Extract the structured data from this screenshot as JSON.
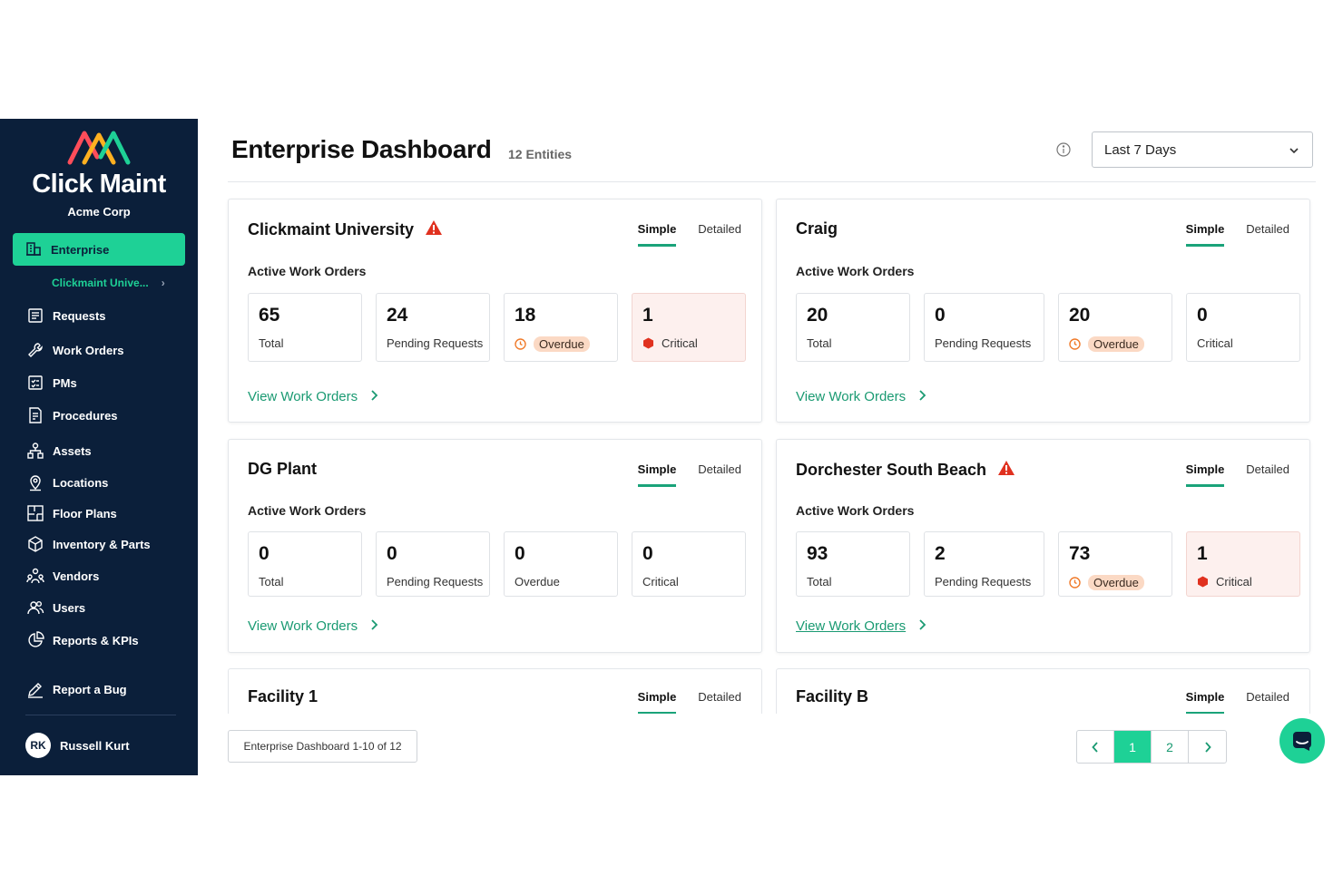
{
  "app": {
    "brand": "Click Maint",
    "org": "Acme Corp"
  },
  "sidebar": {
    "active_item": "Enterprise",
    "sub_item": "Clickmaint Unive...",
    "items": [
      {
        "label": "Requests",
        "icon": "requests-icon"
      },
      {
        "label": "Work Orders",
        "icon": "wrench-icon"
      },
      {
        "label": "PMs",
        "icon": "checklist-icon"
      },
      {
        "label": "Procedures",
        "icon": "procedure-icon"
      },
      {
        "label": "Assets",
        "icon": "assets-icon"
      },
      {
        "label": "Locations",
        "icon": "location-pin-icon"
      },
      {
        "label": "Floor Plans",
        "icon": "floor-plan-icon"
      },
      {
        "label": "Inventory & Parts",
        "icon": "box-icon"
      },
      {
        "label": "Vendors",
        "icon": "vendors-icon"
      },
      {
        "label": "Users",
        "icon": "users-icon"
      },
      {
        "label": "Reports & KPIs",
        "icon": "pie-chart-icon"
      }
    ],
    "report_bug": "Report a Bug",
    "user": {
      "initials": "RK",
      "name": "Russell Kurt"
    }
  },
  "header": {
    "title": "Enterprise Dashboard",
    "entities": "12 Entities",
    "range": "Last 7 Days"
  },
  "colors": {
    "sidebar_bg": "#0b1f3a",
    "accent": "#1ed196",
    "link": "#1a9a72",
    "warning": "#e0311f",
    "overdue_pill": "#fbd9c4"
  },
  "cards": [
    {
      "title": "Clickmaint University",
      "warning": true,
      "tab_simple": "Simple",
      "tab_detailed": "Detailed",
      "section": "Active Work Orders",
      "stats": [
        {
          "value": "65",
          "label": "Total"
        },
        {
          "value": "24",
          "label": "Pending Requests"
        },
        {
          "value": "18",
          "label": "Overdue"
        },
        {
          "value": "1",
          "label": "Critical"
        }
      ],
      "link": "View Work Orders"
    },
    {
      "title": "Craig",
      "warning": false,
      "tab_simple": "Simple",
      "tab_detailed": "Detailed",
      "section": "Active Work Orders",
      "stats": [
        {
          "value": "20",
          "label": "Total"
        },
        {
          "value": "0",
          "label": "Pending Requests"
        },
        {
          "value": "20",
          "label": "Overdue"
        },
        {
          "value": "0",
          "label": "Critical"
        }
      ],
      "link": "View Work Orders"
    },
    {
      "title": "DG Plant",
      "warning": false,
      "tab_simple": "Simple",
      "tab_detailed": "Detailed",
      "section": "Active Work Orders",
      "stats": [
        {
          "value": "0",
          "label": "Total"
        },
        {
          "value": "0",
          "label": "Pending Requests"
        },
        {
          "value": "0",
          "label": "Overdue"
        },
        {
          "value": "0",
          "label": "Critical"
        }
      ],
      "link": "View Work Orders"
    },
    {
      "title": "Dorchester South Beach",
      "warning": true,
      "tab_simple": "Simple",
      "tab_detailed": "Detailed",
      "section": "Active Work Orders",
      "stats": [
        {
          "value": "93",
          "label": "Total"
        },
        {
          "value": "2",
          "label": "Pending Requests"
        },
        {
          "value": "73",
          "label": "Overdue"
        },
        {
          "value": "1",
          "label": "Critical"
        }
      ],
      "link": "View Work Orders"
    },
    {
      "title": "Facility 1",
      "tab_simple": "Simple",
      "tab_detailed": "Detailed"
    },
    {
      "title": "Facility B",
      "tab_simple": "Simple",
      "tab_detailed": "Detailed"
    }
  ],
  "footer": {
    "count": "Enterprise Dashboard 1-10 of 12",
    "pages": [
      "1",
      "2"
    ],
    "prev": "‹",
    "next": "›"
  }
}
